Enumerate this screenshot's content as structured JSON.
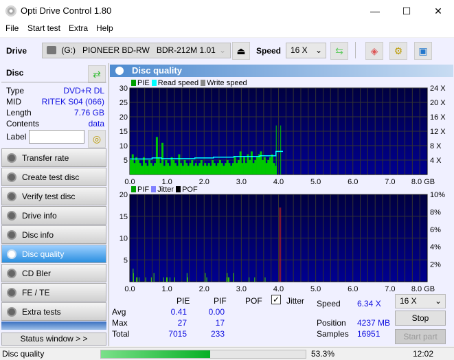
{
  "window": {
    "title": "Opti Drive Control 1.80",
    "minimize": "—",
    "maximize": "☐",
    "close": "✕"
  },
  "menu": [
    "File",
    "Start test",
    "Extra",
    "Help"
  ],
  "toolbar": {
    "drive_label": "Drive",
    "drive_letter": "(G:)",
    "drive_name": "PIONEER BD-RW   BDR-212M 1.01",
    "speed_label": "Speed",
    "speed_value": "16 X"
  },
  "disc": {
    "header": "Disc",
    "rows": [
      {
        "k": "Type",
        "v": "DVD+R DL"
      },
      {
        "k": "MID",
        "v": "RITEK S04 (066)"
      },
      {
        "k": "Length",
        "v": "7.76 GB"
      },
      {
        "k": "Contents",
        "v": "data"
      }
    ],
    "label_label": "Label",
    "label_value": ""
  },
  "nav": [
    {
      "label": "Transfer rate"
    },
    {
      "label": "Create test disc"
    },
    {
      "label": "Verify test disc"
    },
    {
      "label": "Drive info"
    },
    {
      "label": "Disc info"
    },
    {
      "label": "Disc quality",
      "selected": true
    },
    {
      "label": "CD Bler"
    },
    {
      "label": "FE / TE"
    },
    {
      "label": "Extra tests"
    }
  ],
  "status_window_btn": "Status window > >",
  "panel_title": "Disc quality",
  "chart_data": [
    {
      "type": "bar",
      "legend": [
        "PIE",
        "Read speed",
        "Write speed"
      ],
      "colors": {
        "PIE": "#00c800",
        "Read speed": "#00ffff",
        "Write speed": "#888888"
      },
      "xlim": [
        0,
        8
      ],
      "ylim": [
        0,
        30
      ],
      "y2lim": [
        0,
        24
      ],
      "xticks": [
        "0.0",
        "1.0",
        "2.0",
        "3.0",
        "4.0",
        "5.0",
        "6.0",
        "7.0",
        "8.0 GB"
      ],
      "yticks": [
        "5",
        "10",
        "15",
        "20",
        "25",
        "30"
      ],
      "y2ticks": [
        "4 X",
        "8 X",
        "12 X",
        "16 X",
        "20 X",
        "24 X"
      ],
      "pie_x_step": 0.05,
      "pie": [
        5,
        7,
        4,
        6,
        5,
        4,
        3,
        6,
        4,
        3,
        5,
        4,
        3,
        4,
        13,
        6,
        4,
        11,
        3,
        5,
        4,
        3,
        6,
        5,
        4,
        3,
        7,
        4,
        3,
        5,
        4,
        3,
        4,
        5,
        3,
        4,
        3,
        4,
        5,
        3,
        4,
        3,
        4,
        3,
        5,
        4,
        3,
        4,
        5,
        4,
        3,
        4,
        5,
        4,
        3,
        4,
        6,
        4,
        5,
        8,
        4,
        6,
        4,
        7,
        5,
        8,
        4,
        5,
        6,
        7,
        8,
        5,
        6,
        4,
        5,
        6,
        7,
        4,
        3
      ],
      "pie_spikes": [
        [
          3.93,
          17
        ],
        [
          4.05,
          17
        ]
      ],
      "read_speed": [
        [
          0,
          4.3
        ],
        [
          0.6,
          4.6
        ],
        [
          0.85,
          4.4
        ],
        [
          1.75,
          4.6
        ],
        [
          2.25,
          4.8
        ],
        [
          2.8,
          5.0
        ],
        [
          3.5,
          5.2
        ],
        [
          3.93,
          6.4
        ],
        [
          4.12,
          6.4
        ]
      ]
    },
    {
      "type": "bar",
      "legend": [
        "PIF",
        "Jitter",
        "POF"
      ],
      "colors": {
        "PIF": "#00c800",
        "Jitter": "#8080ff",
        "POF": "#000000"
      },
      "xlim": [
        0,
        8
      ],
      "ylim": [
        0,
        20
      ],
      "y2lim": [
        0,
        10
      ],
      "xticks": [
        "0.0",
        "1.0",
        "2.0",
        "3.0",
        "4.0",
        "5.0",
        "6.0",
        "7.0",
        "8.0 GB"
      ],
      "yticks": [
        "5",
        "10",
        "15",
        "20"
      ],
      "y2ticks": [
        "2%",
        "4%",
        "6%",
        "8%",
        "10%"
      ],
      "pif": [
        [
          0.08,
          3
        ],
        [
          0.09,
          2
        ],
        [
          0.17,
          1
        ],
        [
          0.19,
          1
        ],
        [
          0.24,
          1
        ],
        [
          0.42,
          1
        ],
        [
          0.57,
          1
        ],
        [
          0.64,
          2
        ],
        [
          0.9,
          1
        ],
        [
          0.98,
          1
        ],
        [
          1.0,
          1
        ],
        [
          1.07,
          1
        ],
        [
          1.2,
          1
        ],
        [
          1.53,
          2
        ],
        [
          1.55,
          1
        ],
        [
          2.02,
          2
        ],
        [
          2.06,
          1
        ],
        [
          2.6,
          1
        ],
        [
          2.61,
          2
        ],
        [
          2.64,
          1
        ],
        [
          2.66,
          1
        ],
        [
          2.78,
          2
        ],
        [
          3.2,
          1
        ],
        [
          3.35,
          1
        ],
        [
          3.63,
          1
        ]
      ],
      "spikes_red": [
        [
          4.01,
          17
        ],
        [
          4.05,
          17
        ]
      ]
    }
  ],
  "stats": {
    "cols": [
      "PIE",
      "PIF",
      "POF"
    ],
    "jitter_label": "Jitter",
    "jitter_checked": true,
    "rows": [
      {
        "k": "Avg",
        "pie": "0.41",
        "pif": "0.00"
      },
      {
        "k": "Max",
        "pie": "27",
        "pif": "17"
      },
      {
        "k": "Total",
        "pie": "7015",
        "pif": "233"
      }
    ],
    "speed_label": "Speed",
    "speed": "6.34 X",
    "position_label": "Position",
    "position": "4237 MB",
    "samples_label": "Samples",
    "samples": "16951",
    "speed_select": "16 X",
    "stop": "Stop",
    "start_part": "Start part"
  },
  "statusbar": {
    "text": "Disc quality",
    "progress": 53.3,
    "progress_text": "53.3%",
    "time": "12:02"
  }
}
